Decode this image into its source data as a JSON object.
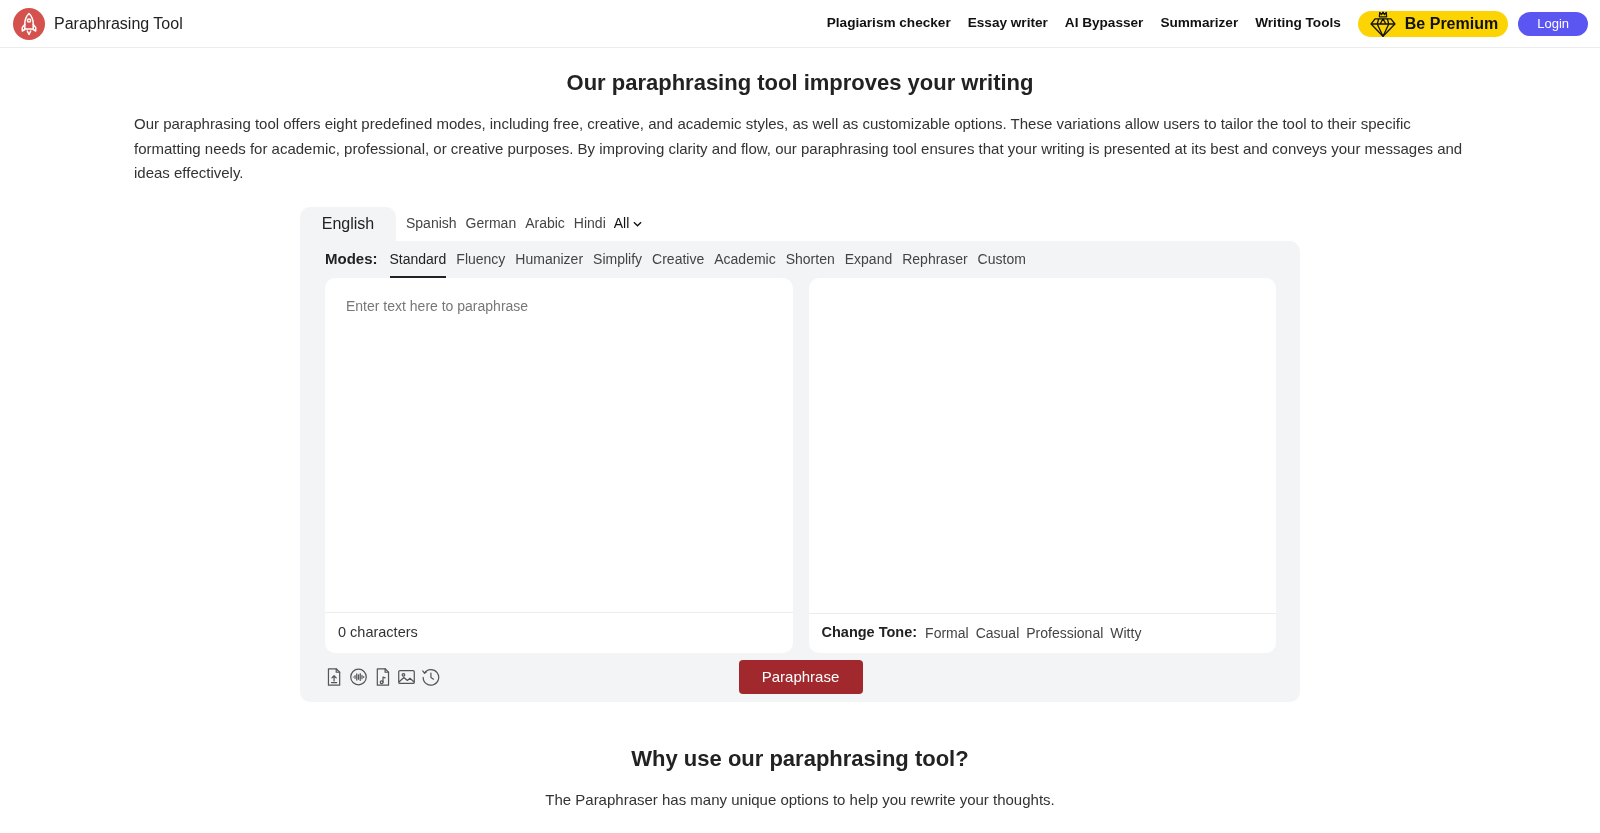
{
  "header": {
    "logo_title": "Paraphrasing Tool",
    "nav": [
      "Plagiarism checker",
      "Essay writer",
      "AI Bypasser",
      "Summarizer",
      "Writing Tools"
    ],
    "premium_button": "Be Premium",
    "login_button": "Login"
  },
  "intro": {
    "title": "Our paraphrasing tool improves your writing",
    "paragraph": "Our paraphrasing tool offers eight predefined modes, including free, creative, and academic styles, as well as customizable options. These variations allow users to tailor the tool to their specific formatting needs for academic, professional, or creative purposes. By improving clarity and flow, our paraphrasing tool ensures that your writing is presented at its best and conveys your messages and ideas effectively."
  },
  "tool": {
    "languages": [
      {
        "label": "English",
        "selected": true
      },
      {
        "label": "Spanish",
        "selected": false
      },
      {
        "label": "German",
        "selected": false
      },
      {
        "label": "Arabic",
        "selected": false
      },
      {
        "label": "Hindi",
        "selected": false
      }
    ],
    "more_languages": "All",
    "modes_label": "Modes:",
    "modes": [
      {
        "label": "Standard",
        "selected": true
      },
      {
        "label": "Fluency",
        "selected": false
      },
      {
        "label": "Humanizer",
        "selected": false
      },
      {
        "label": "Simplify",
        "selected": false
      },
      {
        "label": "Creative",
        "selected": false
      },
      {
        "label": "Academic",
        "selected": false
      },
      {
        "label": "Shorten",
        "selected": false
      },
      {
        "label": "Expand",
        "selected": false
      },
      {
        "label": "Rephraser",
        "selected": false
      },
      {
        "label": "Custom",
        "selected": false
      }
    ],
    "input": {
      "placeholder": "Enter text here to paraphrase",
      "count": "0 characters"
    },
    "tone_label": "Change Tone:",
    "tones": [
      "Formal",
      "Casual",
      "Professional",
      "Witty"
    ],
    "paraphrase_button": "Paraphrase"
  },
  "why": {
    "title": "Why use our paraphrasing tool?",
    "subtitle": "The Paraphraser has many unique options to help you rewrite your thoughts."
  }
}
